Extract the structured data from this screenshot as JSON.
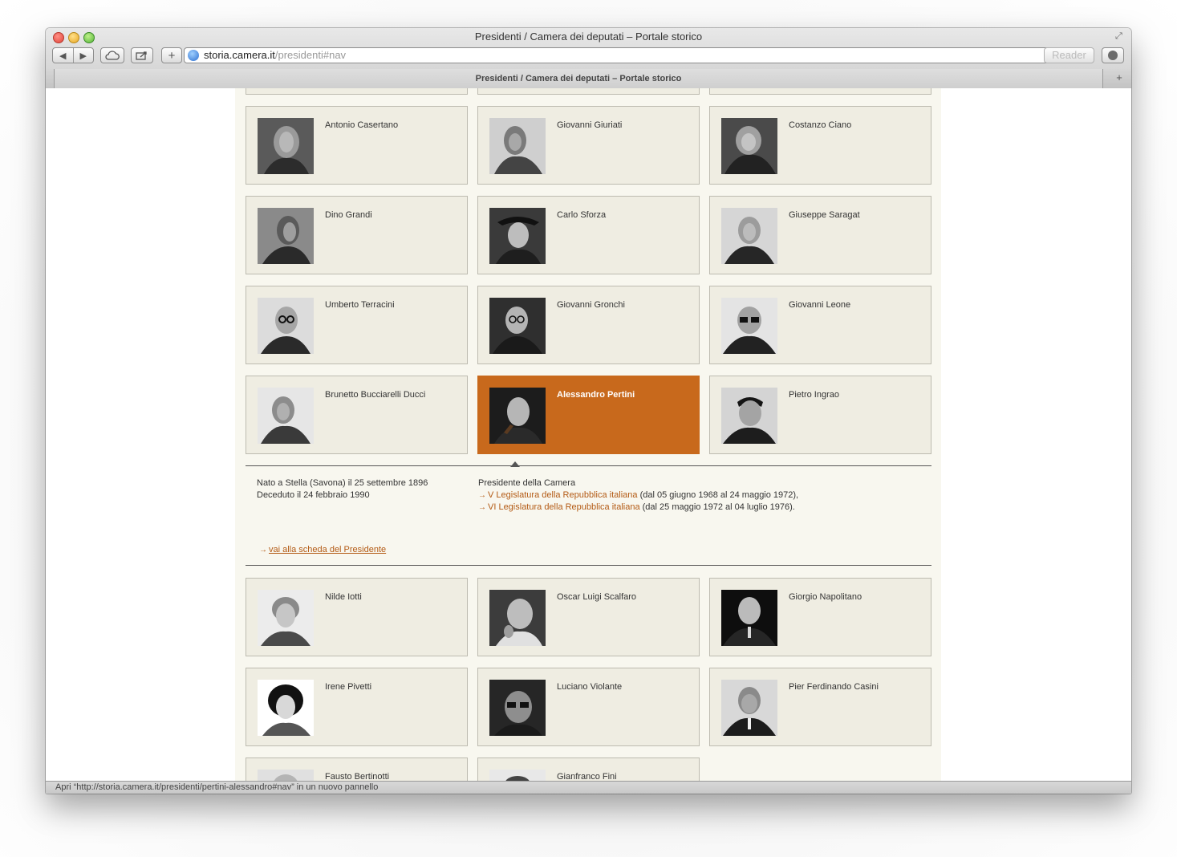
{
  "window": {
    "title": "Presidenti / Camera dei deputati – Portale storico",
    "tab_title": "Presidenti / Camera dei deputati – Portale storico",
    "url_host": "storia.camera.it",
    "url_path": "/presidenti#nav",
    "reader_label": "Reader",
    "status_text": "Apri “http://storia.camera.it/presidenti/pertini-alessandro#nav” in un nuovo pannello"
  },
  "presidents": [
    {
      "name": "Antonio Casertano"
    },
    {
      "name": "Giovanni Giuriati"
    },
    {
      "name": "Costanzo Ciano"
    },
    {
      "name": "Dino Grandi"
    },
    {
      "name": "Carlo Sforza"
    },
    {
      "name": "Giuseppe Saragat"
    },
    {
      "name": "Umberto Terracini"
    },
    {
      "name": "Giovanni Gronchi"
    },
    {
      "name": "Giovanni Leone"
    },
    {
      "name": "Brunetto Bucciarelli Ducci"
    },
    {
      "name": "Alessandro Pertini",
      "selected": true
    },
    {
      "name": "Pietro Ingrao"
    },
    {
      "name": "Nilde Iotti"
    },
    {
      "name": "Oscar Luigi Scalfaro"
    },
    {
      "name": "Giorgio Napolitano"
    },
    {
      "name": "Irene Pivetti"
    },
    {
      "name": "Luciano Violante"
    },
    {
      "name": "Pier Ferdinando Casini"
    },
    {
      "name": "Fausto Bertinotti"
    },
    {
      "name": "Gianfranco Fini"
    }
  ],
  "detail": {
    "birth": "Nato a Stella (Savona) il 25 settembre 1896",
    "death": "Deceduto il 24 febbraio 1990",
    "role": "Presidente della Camera",
    "legislatures": [
      {
        "link": "V Legislatura della Repubblica italiana",
        "dates": "(dal 05 giugno 1968 al 24 maggio 1972),"
      },
      {
        "link": "VI Legislatura della Repubblica italiana",
        "dates": "(dal 25 maggio 1972 al 04 luglio 1976)."
      }
    ],
    "profile_link": "vai alla scheda del Presidente"
  },
  "colors": {
    "accent": "#c8691c",
    "card_bg": "#efede2",
    "content_bg": "#f8f7ef",
    "link": "#b35a14"
  }
}
